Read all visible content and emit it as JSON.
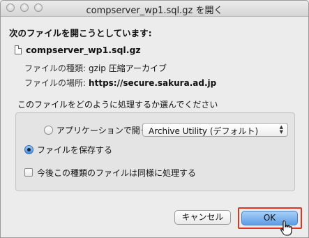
{
  "window": {
    "title": "compserver_wp1.sql.gz を開く"
  },
  "dialog": {
    "heading": "次のファイルを開こうとしています:",
    "filename": "compserver_wp1.sql.gz",
    "file_type_label": "ファイルの種類:",
    "file_type_value": "gzip 圧縮アーカイブ",
    "file_location_label": "ファイルの場所:",
    "file_location_value": "https://secure.sakura.ad.jp",
    "question": "このファイルをどのように処理するか選んでください",
    "open_with_label": "アプリケーションで開く:",
    "open_with_selected": "Archive Utility (デフォルト)",
    "open_with_checked": false,
    "save_file_label": "ファイルを保存する",
    "save_file_checked": true,
    "remember_label": "今後この種類のファイルは同様に処理する",
    "remember_checked": false,
    "cancel_label": "キャンセル",
    "ok_label": "OK"
  },
  "icons": {
    "file": "document-icon",
    "cursor": "hand-pointer-icon"
  },
  "colors": {
    "highlight_outline": "#e0341d",
    "default_button": "#5e9de6"
  }
}
